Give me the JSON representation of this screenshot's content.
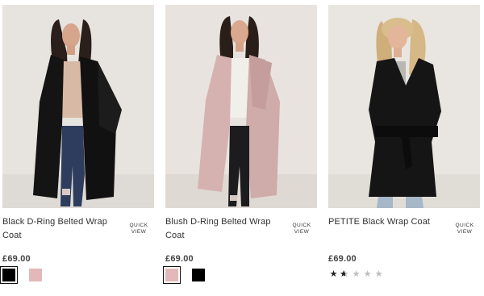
{
  "products": [
    {
      "title": "Black D-Ring Belted Wrap Coat",
      "quick_view": "QUICK VIEW",
      "price": "£69.00",
      "swatches": [
        {
          "color": "#000000",
          "selected": true
        },
        {
          "color": "#e2b8b8",
          "selected": false
        }
      ]
    },
    {
      "title": "Blush D-Ring Belted Wrap Coat",
      "quick_view": "QUICK VIEW",
      "price": "£69.00",
      "swatches": [
        {
          "color": "#e2b8b8",
          "selected": true
        },
        {
          "color": "#000000",
          "selected": false
        }
      ]
    },
    {
      "title": "PETITE Black Wrap Coat",
      "quick_view": "QUICK VIEW",
      "price": "£69.00",
      "rating": {
        "value": 1.5,
        "max": 5
      }
    }
  ]
}
